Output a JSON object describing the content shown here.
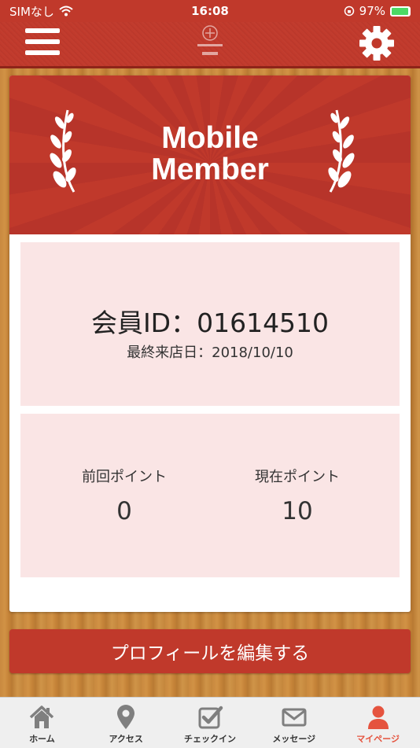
{
  "status_bar": {
    "carrier": "SIMなし",
    "time": "16:08",
    "battery_percent": "97%",
    "battery_level": 0.97
  },
  "header": {
    "menu_icon": "hamburger-menu-icon",
    "settings_icon": "gear-icon"
  },
  "banner": {
    "title_line1": "Mobile",
    "title_line2": "Member"
  },
  "member": {
    "id_text": "会員ID：01614510",
    "last_visit_text": "最終来店日：2018/10/10"
  },
  "points": {
    "previous_label": "前回ポイント",
    "previous_value": "0",
    "current_label": "現在ポイント",
    "current_value": "10"
  },
  "edit_profile_label": "プロフィールを編集する",
  "tabs": [
    {
      "label": "ホーム",
      "icon": "home-icon"
    },
    {
      "label": "アクセス",
      "icon": "map-pin-icon"
    },
    {
      "label": "チェックイン",
      "icon": "checkbox-icon"
    },
    {
      "label": "メッセージ",
      "icon": "envelope-icon"
    },
    {
      "label": "マイページ",
      "icon": "person-icon"
    }
  ],
  "colors": {
    "primary_red": "#c0392b",
    "panel_pink": "#fae5e5",
    "active_tab": "#e5533e",
    "inactive_tab_icon": "#7f7f7f"
  }
}
